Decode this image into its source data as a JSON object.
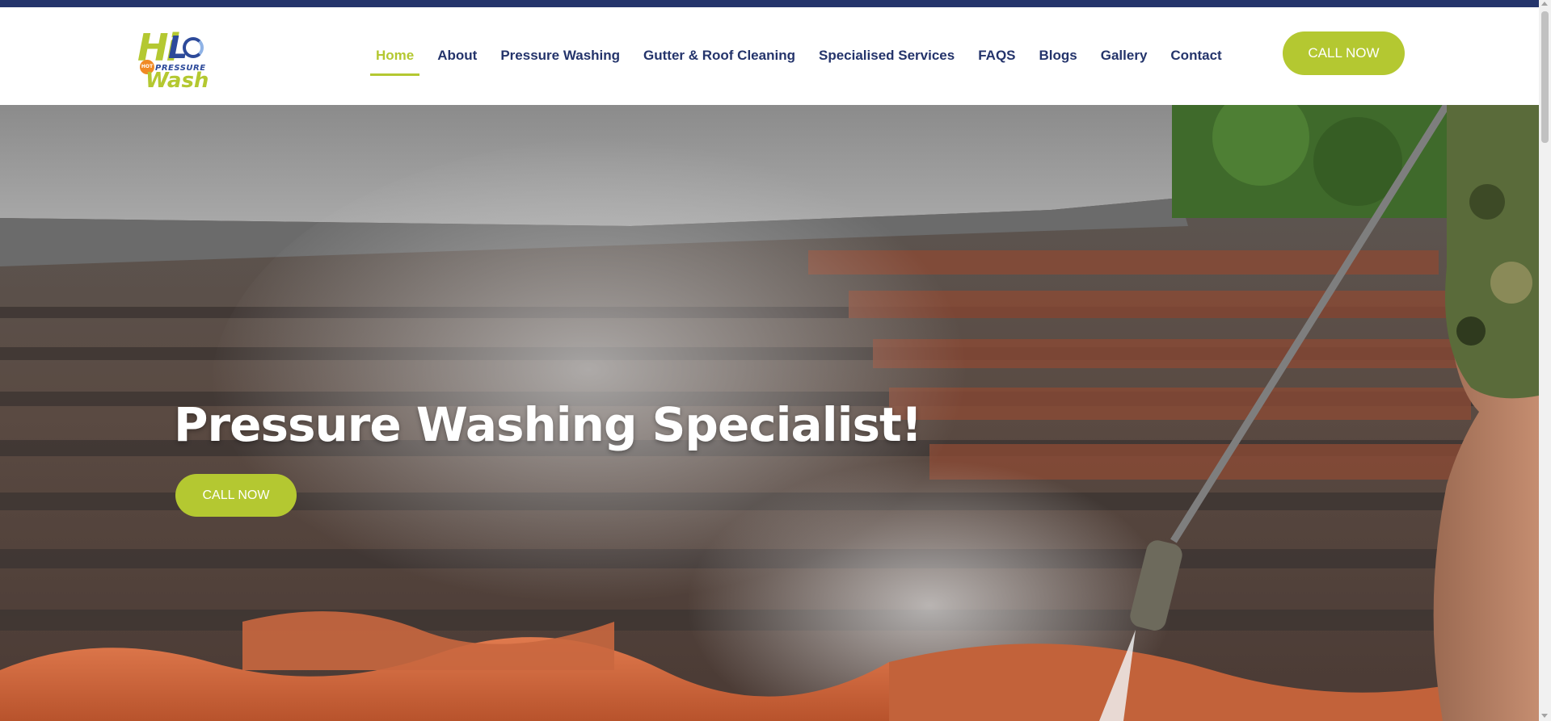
{
  "brand": {
    "logo_line1_a": "Hi",
    "logo_line1_b": "L",
    "logo_badge": "HOT",
    "logo_line2": "PRESSURE",
    "logo_line3": "Wash"
  },
  "nav": {
    "items": [
      {
        "label": "Home",
        "active": true
      },
      {
        "label": "About",
        "active": false
      },
      {
        "label": "Pressure Washing",
        "active": false
      },
      {
        "label": "Gutter & Roof Cleaning",
        "active": false
      },
      {
        "label": "Specialised Services",
        "active": false
      },
      {
        "label": "FAQS",
        "active": false
      },
      {
        "label": "Blogs",
        "active": false
      },
      {
        "label": "Gallery",
        "active": false
      },
      {
        "label": "Contact",
        "active": false
      }
    ],
    "cta_label": "CALL NOW"
  },
  "hero": {
    "title": "Pressure Washing Specialist!",
    "cta_label": "CALL NOW",
    "image": "roof-tiles-pressure-washing-photo"
  },
  "colors": {
    "accent": "#b4c831",
    "navy": "#24346b",
    "topbar": "#24346b"
  }
}
